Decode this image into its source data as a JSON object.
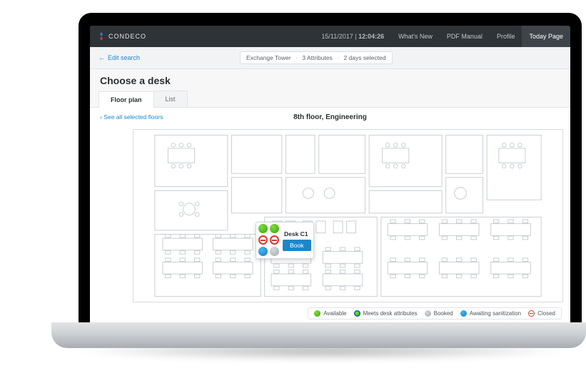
{
  "header": {
    "brand": "CONDECO",
    "datetime_date": "15/11/2017",
    "datetime_time": "12:04:26",
    "nav": {
      "whats_new": "What's New",
      "pdf_manual": "PDF Manual",
      "profile": "Profile",
      "today": "Today Page"
    }
  },
  "subbar": {
    "edit_search": "Edit search",
    "crumb_building": "Exchange Tower",
    "crumb_attrs": "3 Attributes",
    "crumb_days": "2 days selected"
  },
  "page": {
    "title": "Choose a desk",
    "tabs": {
      "floorplan": "Floor plan",
      "list": "List"
    },
    "see_all": "See all selected floors",
    "floor_title": "8th floor, Engineering"
  },
  "popover": {
    "desk_label": "Desk C1",
    "book": "Book"
  },
  "legend": {
    "available": "Available",
    "meets": "Meets desk attributes",
    "booked": "Booked",
    "awaiting": "Awaiting sanitization",
    "closed": "Closed"
  }
}
